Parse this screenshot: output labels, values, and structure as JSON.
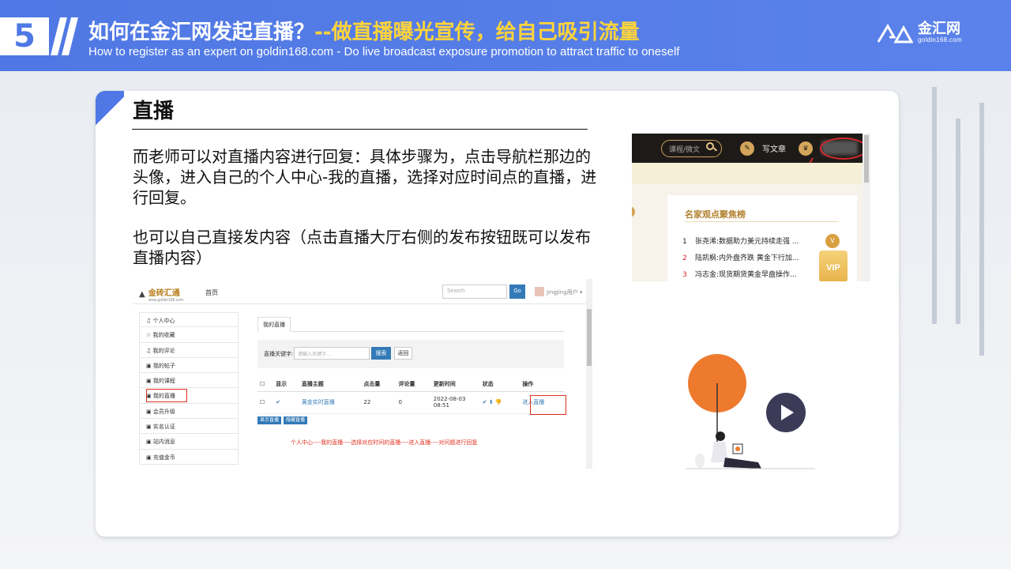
{
  "header": {
    "number": "5",
    "title_main": "如何在金汇网发起直播？",
    "title_highlight": "--做直播曝光宣传，给自己吸引流量",
    "subtitle": "How to register as an expert on goldin168.com - Do live broadcast exposure promotion to attract traffic to oneself",
    "logo_name": "金汇网",
    "logo_domain": "goldin168.com",
    "accent_color": "#4f78e4",
    "highlight_color": "#ffd43b"
  },
  "card": {
    "title": "直播",
    "paragraph1": "而老师可以对直播内容进行回复：具体步骤为，点击导航栏那边的头像，进入自己的个人中心-我的直播，选择对应时间点的直播，进行回复。",
    "paragraph2": "也可以自己直接发内容（点击直播大厅右侧的发布按钮既可以发布直播内容）"
  },
  "screenshot_left": {
    "logo": "金砖汇通",
    "logo_sub": "www.goldin168.com",
    "home": "首页",
    "search_placeholder": "Search",
    "go": "Go",
    "user": "Jingjing用户 ▾",
    "sidebar": [
      "♫ 个人中心",
      "☆ 我的收藏",
      "♫ 我的评论",
      "▣ 我的帖子",
      "▣ 我的课程",
      "▣ 我的直播",
      "▣ 会员升级",
      "▣ 实名认证",
      "▣ 站内消息",
      "▣ 充值金币"
    ],
    "tab": "我的直播",
    "filter_label": "直播关键字:",
    "filter_placeholder": "请输入关键字...",
    "filter_btn": "搜索",
    "back_btn": "返回",
    "columns": [
      "☐",
      "显示",
      "直播主题",
      "点击量",
      "评论量",
      "更新时间",
      "状态",
      "操作"
    ],
    "row": {
      "check": "☐",
      "show": "✔",
      "topic": "黄金实时直播",
      "clicks": "22",
      "comments": "0",
      "updated": "2022-08-03 08:51",
      "status": "✔ ⬇ 👎",
      "action": "进入直播"
    },
    "btn_show": "显示直播",
    "btn_hide": "隐藏直播",
    "note": "个人中心----我的直播----选择对应时间的直播----进入直播----对问题进行回复"
  },
  "screenshot_right": {
    "search": "课程/微文",
    "write": "写文章",
    "pen_icon": "✎",
    "crown_icon": "♛",
    "panel_title": "名家观点聚焦榜",
    "items": [
      {
        "n": "1",
        "text": "张尧浠:数据助力美元持续走强 ..."
      },
      {
        "n": "2",
        "text": "陆凯枫:内外盘齐跌 黄金下行加..."
      },
      {
        "n": "3",
        "text": "冯志金:现货期货黄金早盘操作..."
      }
    ],
    "vip": "VIP",
    "medal": "V"
  }
}
